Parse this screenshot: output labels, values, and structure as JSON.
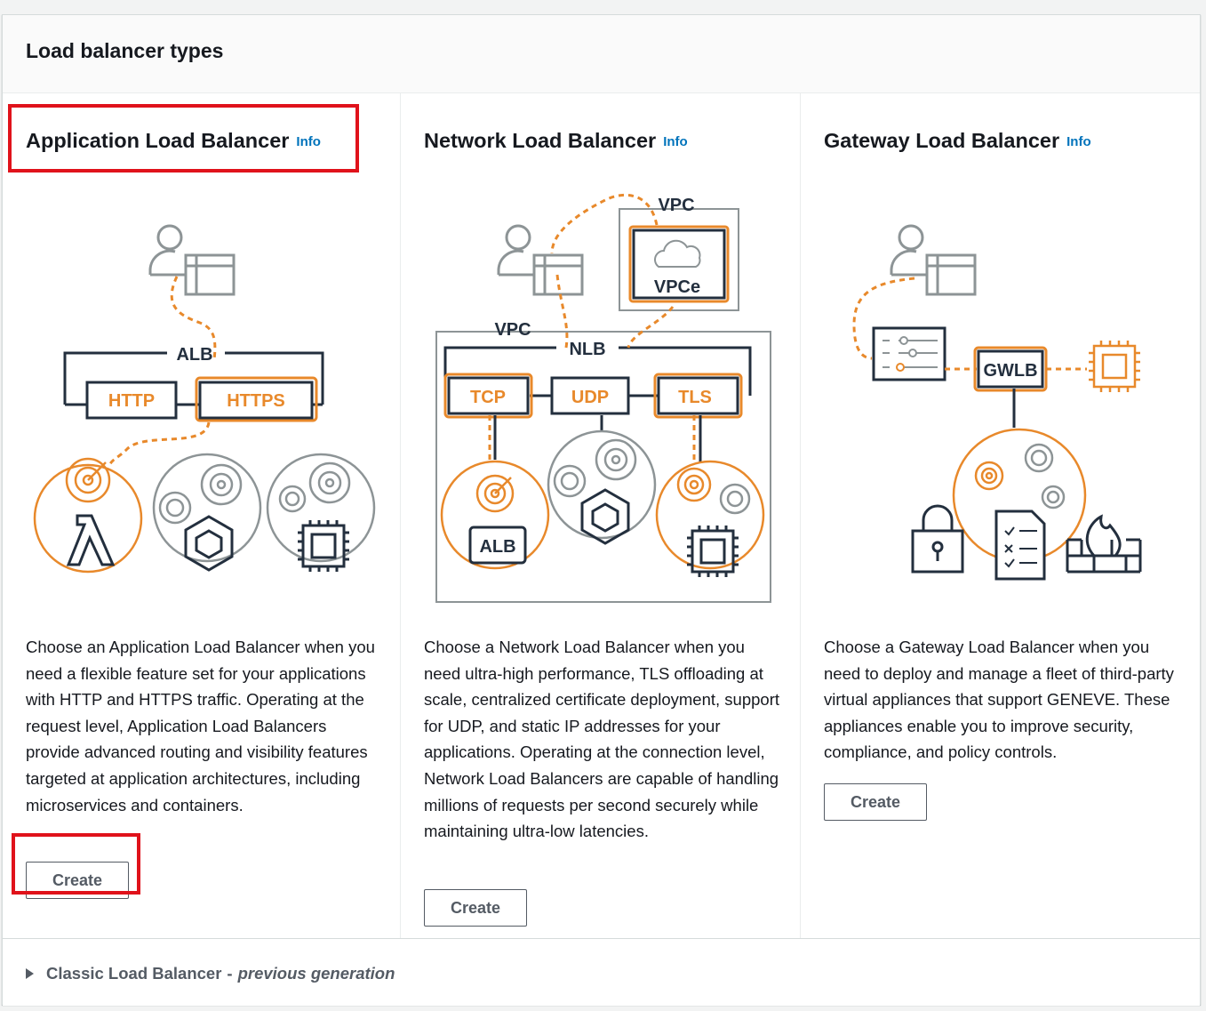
{
  "panel": {
    "title": "Load balancer types"
  },
  "alb": {
    "title": "Application Load Balancer",
    "info": "Info",
    "diagram": {
      "group": "ALB",
      "listeners": [
        "HTTP",
        "HTTPS"
      ]
    },
    "description": "Choose an Application Load Balancer when you need a flexible feature set for your applications with HTTP and HTTPS traffic. Operating at the request level, Application Load Balancers provide advanced routing and visibility features targeted at application architectures, including microservices and containers.",
    "create_label": "Create"
  },
  "nlb": {
    "title": "Network Load Balancer",
    "info": "Info",
    "diagram": {
      "vpc_top": "VPC",
      "endpoint": "VPCe",
      "vpc": "VPC",
      "group": "NLB",
      "listeners": [
        "TCP",
        "UDP",
        "TLS"
      ],
      "target": "ALB"
    },
    "description": "Choose a Network Load Balancer when you need ultra-high performance, TLS offloading at scale, centralized certificate deployment, support for UDP, and static IP addresses for your applications. Operating at the connection level, Network Load Balancers are capable of handling millions of requests per second securely while maintaining ultra-low latencies.",
    "create_label": "Create"
  },
  "gwlb": {
    "title": "Gateway Load Balancer",
    "info": "Info",
    "diagram": {
      "group": "GWLB"
    },
    "description": "Choose a Gateway Load Balancer when you need to deploy and manage a fleet of third-party virtual appliances that support GENEVE. These appliances enable you to improve security, compliance, and policy controls.",
    "create_label": "Create"
  },
  "footer": {
    "title": "Classic Load Balancer",
    "separator": "-",
    "subtitle": "previous generation"
  },
  "colors": {
    "orange": "#e8892b",
    "dark": "#232f3e",
    "gray": "#8d9496",
    "link": "#0073bb",
    "highlight": "#e0121b"
  }
}
